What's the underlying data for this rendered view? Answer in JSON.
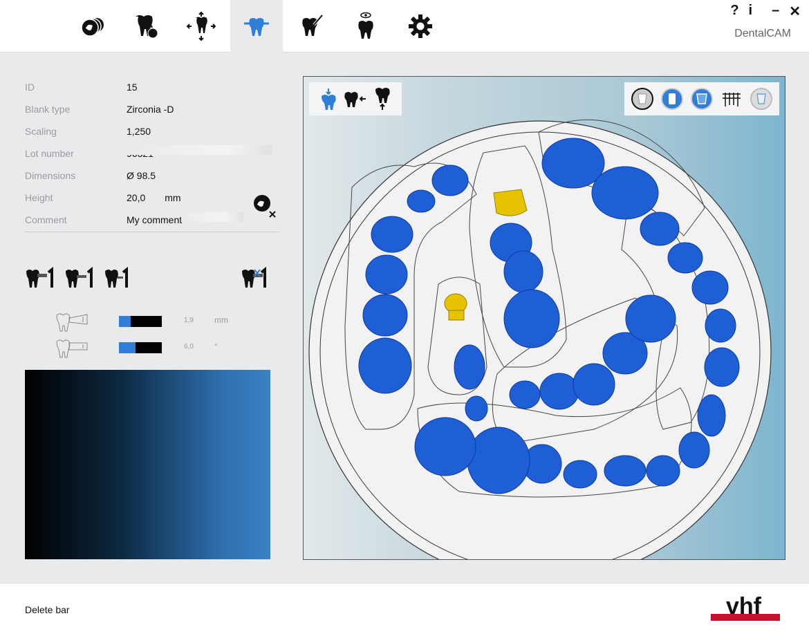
{
  "window": {
    "brand": "DentalCAM",
    "help_label": "?",
    "info_label": "i",
    "minimize_label": "–",
    "close_label": "✕"
  },
  "toolbar": {
    "tools": [
      {
        "icon": "blank-stack-icon",
        "active": false
      },
      {
        "icon": "tooth-blank-assign-icon",
        "active": false
      },
      {
        "icon": "tooth-move-icon",
        "active": false
      },
      {
        "icon": "tooth-support-bar-icon",
        "active": true
      },
      {
        "icon": "tooth-mill-icon",
        "active": false
      },
      {
        "icon": "tooth-view-icon",
        "active": false
      },
      {
        "icon": "gear-icon",
        "active": false
      }
    ]
  },
  "properties": [
    {
      "label": "ID",
      "value": "15",
      "unit": ""
    },
    {
      "label": "Blank type",
      "value": "Zirconia -D",
      "unit": ""
    },
    {
      "label": "Scaling",
      "value": "1,250",
      "unit": ""
    },
    {
      "label": "Lot number",
      "value": "96321",
      "unit": ""
    },
    {
      "label": "Dimensions",
      "value": "Ø 98.5",
      "unit": ""
    },
    {
      "label": "Height",
      "value": "20,0",
      "unit": "mm"
    },
    {
      "label": "Comment",
      "value": "My comment",
      "unit": ""
    }
  ],
  "sliders": [
    {
      "name": "bar-diameter",
      "value": "1,9",
      "unit": "mm",
      "fill": 0.27
    },
    {
      "name": "bar-angle",
      "value": "6,0",
      "unit": "°",
      "fill": 0.38
    }
  ],
  "footer": {
    "status_text": "Delete bar",
    "logo_text": "vhf"
  },
  "colors": {
    "accent": "#2f7fd8",
    "model": "#1f5fd6",
    "selected": "#e6c200",
    "logo_red": "#c8102e"
  }
}
